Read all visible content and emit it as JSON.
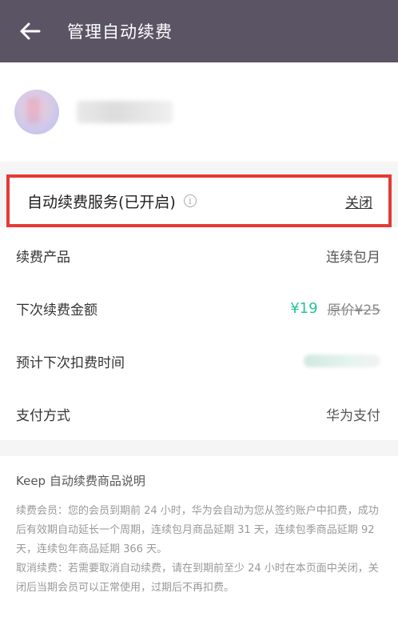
{
  "header": {
    "title": "管理自动续费"
  },
  "service": {
    "label": "自动续费服务(已开启)",
    "close_label": "关闭"
  },
  "details": {
    "product_label": "续费产品",
    "product_value": "连续包月",
    "amount_label": "下次续费金额",
    "amount_new": "¥19",
    "amount_old": "原价¥25",
    "next_time_label": "预计下次扣费时间",
    "payment_label": "支付方式",
    "payment_value": "华为支付"
  },
  "notes": {
    "title": "Keep 自动续费商品说明",
    "paragraph1": "续费会员：您的会员到期前 24 小时，华为会自动为您从签约账户中扣费，成功后有效期自动延长一个周期，连续包月商品延期 31 天，连续包季商品延期 92 天，连续包年商品延期 366 天。",
    "paragraph2": "取消续费：若需要取消自动续费，请在到期前至少 24 小时在本页面中关闭，关闭后当期会员可以正常使用，过期后不再扣费。"
  }
}
